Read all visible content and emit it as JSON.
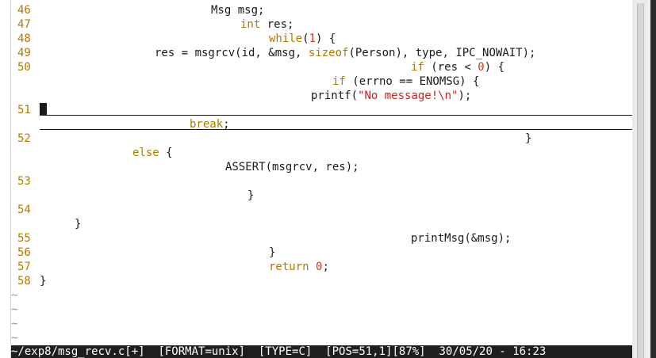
{
  "editor": {
    "lines": [
      {
        "num": "46",
        "segments": [
          {
            "t": "Msg msg;",
            "c": "fn"
          }
        ]
      },
      {
        "num": "47",
        "segments": [
          {
            "t": "int",
            "c": "kw"
          },
          {
            "t": " res;",
            "c": "fn"
          }
        ]
      },
      {
        "num": "48",
        "segments": [
          {
            "t": "while",
            "c": "kw"
          },
          {
            "t": "(",
            "c": "fn"
          },
          {
            "t": "1",
            "c": "num"
          },
          {
            "t": ") {",
            "c": "fn"
          }
        ]
      },
      {
        "num": "49",
        "segments": [
          {
            "t": "res = msgrcv(id, &msg, ",
            "c": "fn"
          },
          {
            "t": "sizeof",
            "c": "kw"
          },
          {
            "t": "(Person), type, IPC_NOWAIT);",
            "c": "fn"
          }
        ]
      },
      {
        "num": "50",
        "segments": [
          {
            "t": "if",
            "c": "kw"
          },
          {
            "t": " (res < ",
            "c": "fn"
          },
          {
            "t": "0",
            "c": "num"
          },
          {
            "t": ") {",
            "c": "fn"
          }
        ]
      },
      {
        "num": "",
        "segments": [
          {
            "t": "if",
            "c": "kw"
          },
          {
            "t": " (errno == ENOMSG) {",
            "c": "fn"
          }
        ]
      },
      {
        "num": "",
        "segments": [
          {
            "t": "printf(",
            "c": "fn"
          },
          {
            "t": "\"No message!\\n\"",
            "c": "str"
          },
          {
            "t": ");",
            "c": "fn"
          }
        ]
      },
      {
        "num": "51",
        "segments": []
      },
      {
        "num": "",
        "segments": [
          {
            "t": "break",
            "c": "kw"
          },
          {
            "t": ";",
            "c": "fn"
          }
        ]
      },
      {
        "num": "52",
        "segments": [
          {
            "t": "}",
            "c": "fn"
          }
        ]
      },
      {
        "num": "",
        "segments": [
          {
            "t": "else",
            "c": "kw"
          },
          {
            "t": " {",
            "c": "fn"
          }
        ]
      },
      {
        "num": "",
        "segments": [
          {
            "t": "ASSERT(msgrcv, res);",
            "c": "fn"
          }
        ]
      },
      {
        "num": "53",
        "segments": []
      },
      {
        "num": "",
        "segments": [
          {
            "t": "}",
            "c": "fn"
          }
        ]
      },
      {
        "num": "54",
        "segments": []
      },
      {
        "num": "",
        "segments": [
          {
            "t": "}",
            "c": "fn"
          }
        ]
      },
      {
        "num": "55",
        "segments": [
          {
            "t": "printMsg(&msg);",
            "c": "fn"
          }
        ]
      },
      {
        "num": "56",
        "segments": [
          {
            "t": "}",
            "c": "fn"
          }
        ]
      },
      {
        "num": "57",
        "segments": [
          {
            "t": "return",
            "c": "kw"
          },
          {
            "t": " ",
            "c": "fn"
          },
          {
            "t": "0",
            "c": "num"
          },
          {
            "t": ";",
            "c": "fn"
          }
        ]
      },
      {
        "num": "58",
        "segments": [
          {
            "t": "}",
            "c": "fn"
          }
        ]
      }
    ],
    "empty_line_marker": "~"
  },
  "statusbar": {
    "file": "~/exp8/msg_recv.c[+]",
    "format": "[FORMAT=unix]",
    "type": "[TYPE=C]",
    "pos": "[POS=51,1]",
    "percent": "[87%]",
    "datetime": "30/05/20 - 16:23"
  },
  "colors": {
    "keyword": "#b07a00",
    "number": "#c83a2a",
    "string": "#c8221e",
    "line_number": "#b07a00",
    "tilde": "#6a9cc0",
    "statusbar_bg": "#1e1e1e"
  }
}
